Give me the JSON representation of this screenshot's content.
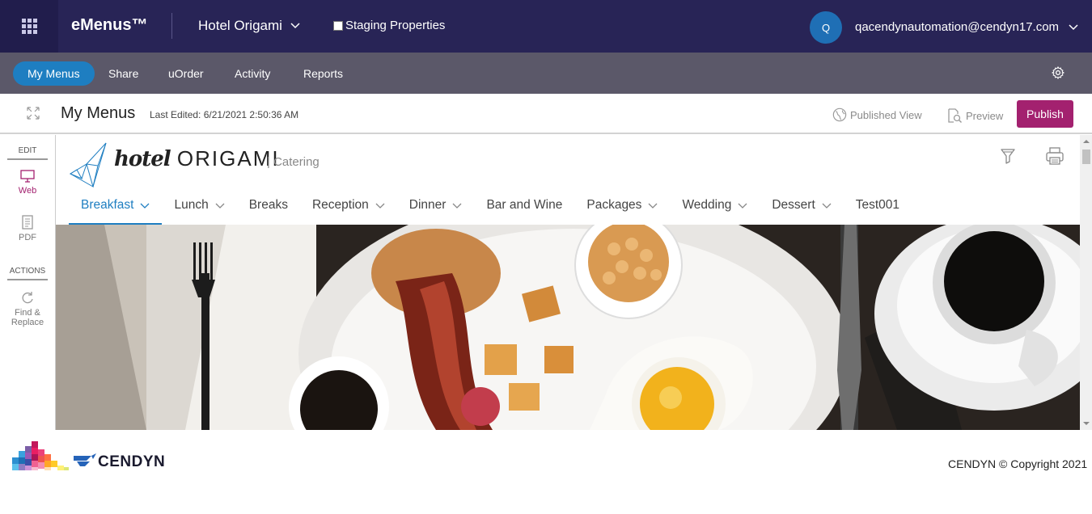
{
  "topbar": {
    "brand": "eMenus™",
    "property": "Hotel Origami",
    "staging_label": "Staging Properties",
    "avatar_initial": "Q",
    "user_email": "qacendynautomation@cendyn17.com"
  },
  "nav": {
    "items": [
      {
        "label": "My Menus",
        "active": true
      },
      {
        "label": "Share"
      },
      {
        "label": "uOrder"
      },
      {
        "label": "Activity"
      },
      {
        "label": "Reports"
      }
    ]
  },
  "header": {
    "title": "My Menus",
    "last_edited": "Last Edited: 6/21/2021 2:50:36 AM",
    "published_view": "Published View",
    "preview": "Preview",
    "publish": "Publish"
  },
  "sidebar": {
    "edit_heading": "EDIT",
    "web": "Web",
    "pdf": "PDF",
    "actions_heading": "ACTIONS",
    "find_replace_1": "Find &",
    "find_replace_2": "Replace"
  },
  "menu": {
    "logo_script": "hotel",
    "logo_caps": "ORIGAMI",
    "subtitle": "| Catering",
    "tabs": [
      {
        "label": "Breakfast",
        "chevron": true,
        "active": true
      },
      {
        "label": "Lunch",
        "chevron": true
      },
      {
        "label": "Breaks",
        "chevron": false
      },
      {
        "label": "Reception",
        "chevron": true
      },
      {
        "label": "Dinner",
        "chevron": true
      },
      {
        "label": "Bar and Wine",
        "chevron": false
      },
      {
        "label": "Packages",
        "chevron": true
      },
      {
        "label": "Wedding",
        "chevron": true
      },
      {
        "label": "Dessert",
        "chevron": true
      },
      {
        "label": "Test001",
        "chevron": false
      }
    ]
  },
  "footer": {
    "brand": "CENDYN",
    "copyright": "CENDYN © Copyright 2021"
  },
  "colors": {
    "topbar": "#282456",
    "navbar": "#5b5869",
    "accent": "#1e7ec1",
    "publish": "#a3216f"
  }
}
